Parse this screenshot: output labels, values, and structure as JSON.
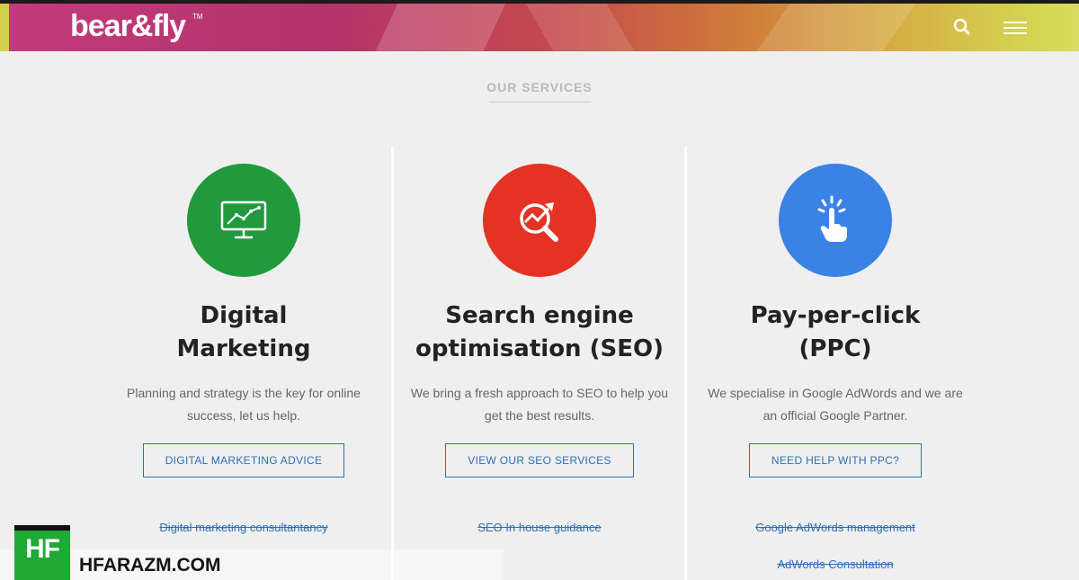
{
  "header": {
    "logo_text": "bear&fly",
    "trademark": "TM",
    "search_icon": "search-icon",
    "menu_icon": "hamburger-menu-icon",
    "gradient_colors": [
      "#c33a7a",
      "#cf7a3a",
      "#d8dc5d"
    ]
  },
  "section": {
    "title": "OUR SERVICES"
  },
  "services": [
    {
      "icon": "monitor-chart-icon",
      "circle_color": "#219a3e",
      "title_line1": "Digital",
      "title_line2": "Marketing",
      "desc_line1": "Planning and strategy is the key for online",
      "desc_line2": "success, let us help.",
      "button": "DIGITAL MARKETING ADVICE",
      "links": [
        "Digital marketing consultantancy"
      ]
    },
    {
      "icon": "seo-magnifier-icon",
      "circle_color": "#e43324",
      "title_line1": "Search engine",
      "title_line2": "optimisation (SEO)",
      "desc_line1": "We bring a fresh approach to SEO to help you",
      "desc_line2": "get the best results.",
      "button": "VIEW OUR SEO SERVICES",
      "links": [
        "SEO In house guidance"
      ]
    },
    {
      "icon": "hand-click-icon",
      "circle_color": "#3a82e6",
      "title_line1": "Pay-per-click",
      "title_line2": "(PPC)",
      "desc_line1": "We specialise in Google AdWords and we are",
      "desc_line2": "an official Google Partner.",
      "button": "NEED HELP WITH PPC?",
      "links": [
        "Google AdWords management",
        "AdWords Consultation"
      ]
    }
  ],
  "watermark": {
    "badge": "HF",
    "text": "HFARAZM.COM",
    "color": "#1faa35"
  },
  "colors": {
    "accent_blue": "#2f6fb6",
    "background": "#efefef"
  }
}
